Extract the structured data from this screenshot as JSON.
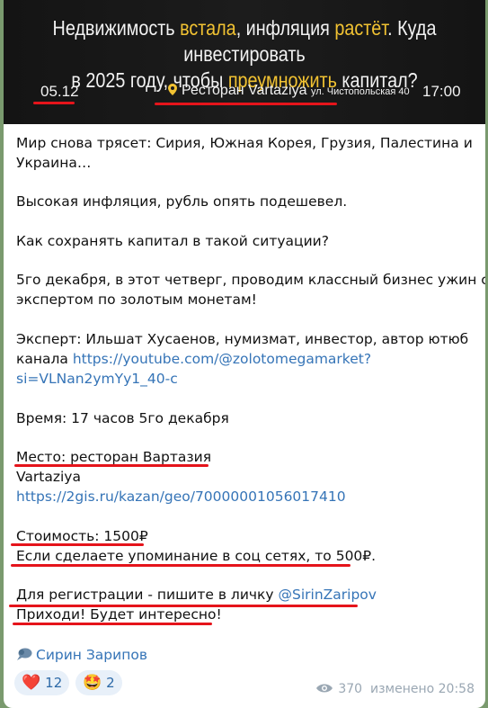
{
  "banner": {
    "title_line1_pre": "Недвижимость ",
    "title_line1_hl1": "встала",
    "title_line1_mid": ", инфляция ",
    "title_line1_hl2": "растёт",
    "title_line1_post": ". Куда инвестировать",
    "title_line2_pre": "в 2025 году, чтобы ",
    "title_line2_hl": "преумножить",
    "title_line2_post": " капитал?",
    "date": "05.12",
    "venue": "Ресторан Vartaziya",
    "address": "ул. Чистопольская 40",
    "time": "17:00",
    "highlight_color": "#f1c232"
  },
  "message": {
    "p1": "Мир снова трясет: Сирия, Южная Корея, Грузия, Палестина и",
    "p1b": "Украина…",
    "p2": "Высокая инфляция, рубль опять подешевел.",
    "p3": "Как сохранять капитал в такой ситуации?",
    "p4a": " 5го декабря, в этот четверг, проводим классный бизнес ужин с",
    "p4b": "экспертом по золотым монетам!",
    "p5a": "Эксперт: Ильшат Хусаенов, нумизмат, инвестор, автор ютюб",
    "p5b_text": "канала ",
    "p5b_link": "https://youtube.com/@zolotomegamarket?",
    "p5c_link": "si=VLNan2ymYy1_40-c",
    "time_line": "Время: 17 часов 5го декабря",
    "place_line": "Место: ресторан Вартазия",
    "place_name": "Vartaziya",
    "place_link": "https://2gis.ru/kazan/geo/70000001056017410",
    "cost_line": "Стоимость: 1500₽",
    "cost_note": "Если сделаете упоминание в соц сетях, то 500₽.",
    "reg_text": "Для регистрации - пишите в личку ",
    "reg_link": "@SirinZaripov",
    "closing": "Приходи! Будет интересно!",
    "author": "Сирин Зарипов"
  },
  "reactions": [
    {
      "emoji": "❤️",
      "count": "12"
    },
    {
      "emoji": "🤩",
      "count": "2"
    }
  ],
  "meta": {
    "views": "370",
    "edited": "изменено 20:58"
  },
  "colors": {
    "link": "#3574b7",
    "underline_red": "#e5141b",
    "background": "#7a9a6e"
  }
}
